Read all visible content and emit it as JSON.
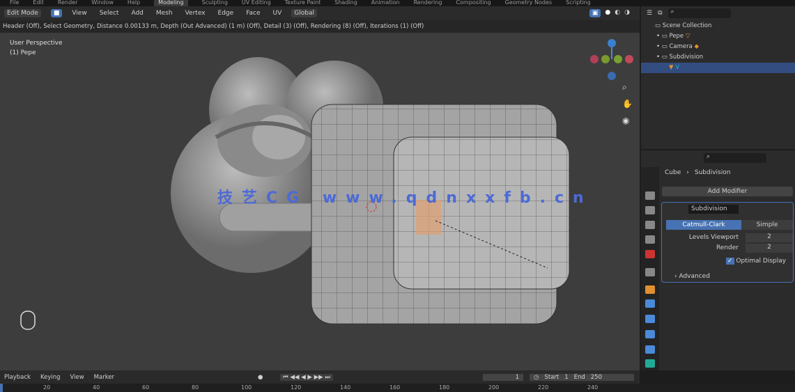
{
  "menu": [
    "File",
    "Edit",
    "Render",
    "Window",
    "Help",
    "Modeling",
    "Sculpting",
    "UV Editing",
    "Texture Paint",
    "Shading",
    "Animation",
    "Rendering",
    "Compositing",
    "Geometry Nodes",
    "Scripting"
  ],
  "active_workspace": "Modeling",
  "viewport_header": {
    "mode": "Edit Mode",
    "menus": [
      "View",
      "Select",
      "Add",
      "Mesh",
      "Vertex",
      "Edge",
      "Face",
      "UV"
    ],
    "orientation": "Global"
  },
  "tool_header": "Header (Off), Select Geometry, Distance 0.00133 m, Depth (Out Advanced) (1 m) (Off), Detail (3) (Off), Rendering (8) (Off), Iterations (1) (Off)",
  "viewport_info": {
    "view": "User Perspective",
    "object": "(1) Pepe"
  },
  "watermark": "技艺CG www.qdnxxfb.cn",
  "outliner": {
    "root": "Scene Collection",
    "items": [
      "Pepe",
      "Camera",
      "Subdivision"
    ]
  },
  "properties": {
    "breadcrumb_object": "Cube",
    "breadcrumb_modifier": "Subdivision",
    "add_modifier": "Add Modifier",
    "modifier_name": "Subdivision",
    "tabs": [
      "Catmull-Clark",
      "Simple"
    ],
    "levels_viewport_label": "Levels Viewport",
    "levels_viewport": "2",
    "render_label": "Render",
    "render": "2",
    "optimal_display": "Optimal Display",
    "advanced": "Advanced"
  },
  "timeline": {
    "menus": [
      "Playback",
      "Keying",
      "View",
      "Marker"
    ],
    "current_frame": "1",
    "start_label": "Start",
    "start": "1",
    "end_label": "End",
    "end": "250"
  },
  "ruler_ticks": [
    "20",
    "40",
    "60",
    "80",
    "100",
    "120",
    "140",
    "160",
    "180",
    "200",
    "220",
    "240"
  ],
  "colors": {
    "accent": "#4772b3",
    "selected_row": "#334d80"
  }
}
